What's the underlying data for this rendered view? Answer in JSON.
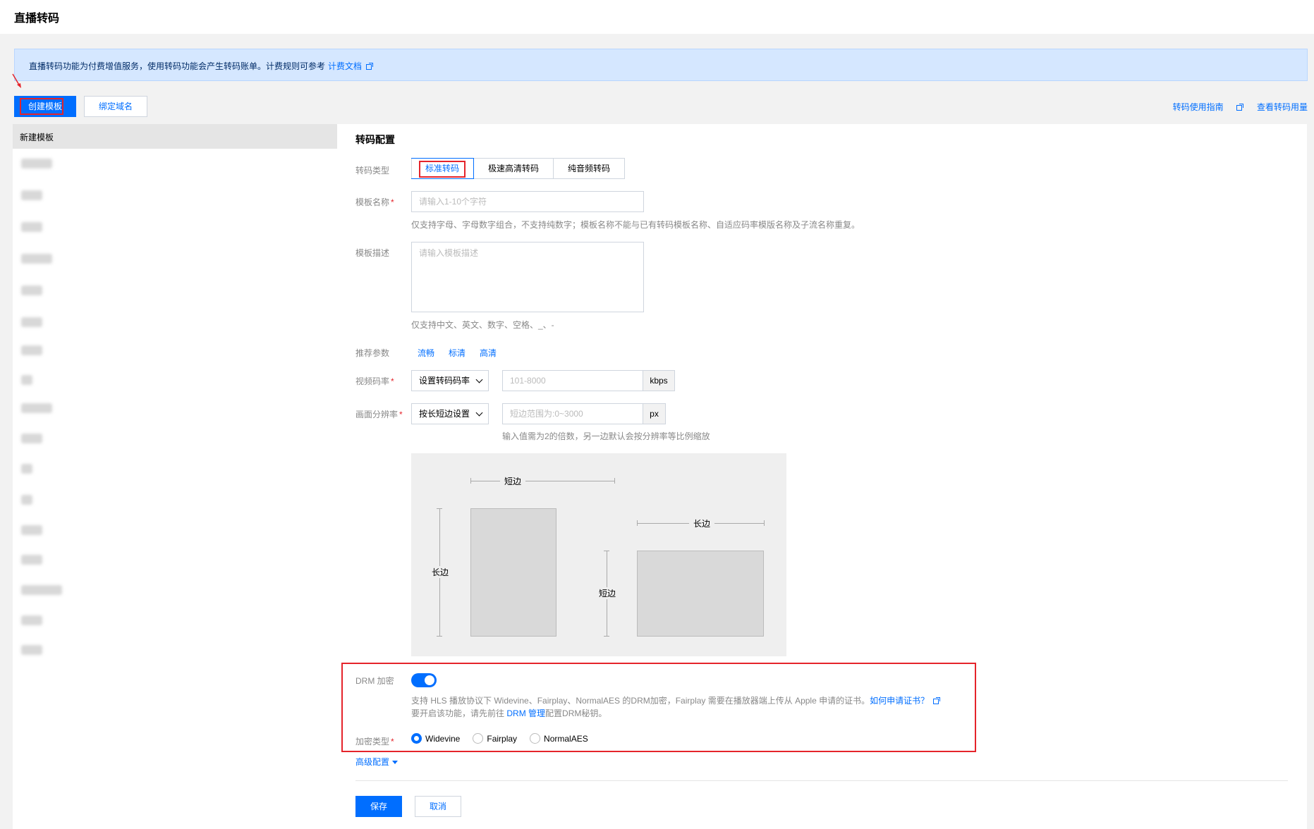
{
  "header": {
    "title": "直播转码"
  },
  "notice": {
    "text": "直播转码功能为付费增值服务，使用转码功能会产生转码账单。计费规则可参考",
    "link": "计费文档"
  },
  "toolbar": {
    "create_template": "创建模板",
    "bind_domain": "绑定域名",
    "usage_guide": "转码使用指南",
    "view_usage": "查看转码用量"
  },
  "sidebar": {
    "header": "新建模板"
  },
  "form": {
    "section_title": "转码配置",
    "transcode_type": {
      "label": "转码类型",
      "options": [
        "标准转码",
        "极速高清转码",
        "纯音频转码"
      ],
      "selected": "标准转码"
    },
    "template_name": {
      "label": "模板名称",
      "placeholder": "请输入1-10个字符",
      "hint": "仅支持字母、字母数字组合，不支持纯数字；模板名称不能与已有转码模板名称、自适应码率模版名称及子流名称重复。"
    },
    "template_desc": {
      "label": "模板描述",
      "placeholder": "请输入模板描述",
      "hint": "仅支持中文、英文、数字、空格、_、-"
    },
    "recommended": {
      "label": "推荐参数",
      "options": [
        "流畅",
        "标清",
        "高清"
      ]
    },
    "video_bitrate": {
      "label": "视频码率",
      "select": "设置转码码率",
      "placeholder": "101-8000",
      "unit": "kbps"
    },
    "resolution": {
      "label": "画面分辨率",
      "select": "按长短边设置",
      "placeholder": "短边范围为:0~3000",
      "unit": "px",
      "hint": "输入值需为2的倍数，另一边默认会按分辨率等比例缩放"
    },
    "diagram": {
      "short_edge": "短边",
      "long_edge": "长边"
    },
    "drm": {
      "label": "DRM 加密",
      "enabled": true,
      "desc_line1": "支持 HLS 播放协议下 Widevine、Fairplay、NormalAES 的DRM加密，Fairplay 需要在播放器端上传从 Apple 申请的证书。",
      "desc_link1": "如何申请证书？",
      "desc_line2_pre": "要开启该功能，请先前往",
      "desc_link2": "DRM 管理",
      "desc_line2_post": "配置DRM秘钥。"
    },
    "encryption_type": {
      "label": "加密类型",
      "options": [
        "Widevine",
        "Fairplay",
        "NormalAES"
      ],
      "selected": "Widevine"
    },
    "advanced": "高级配置",
    "save": "保存",
    "cancel": "取消"
  },
  "colors": {
    "primary": "#006eff",
    "highlight": "#e5242b",
    "notice_bg": "#d5e7ff"
  }
}
